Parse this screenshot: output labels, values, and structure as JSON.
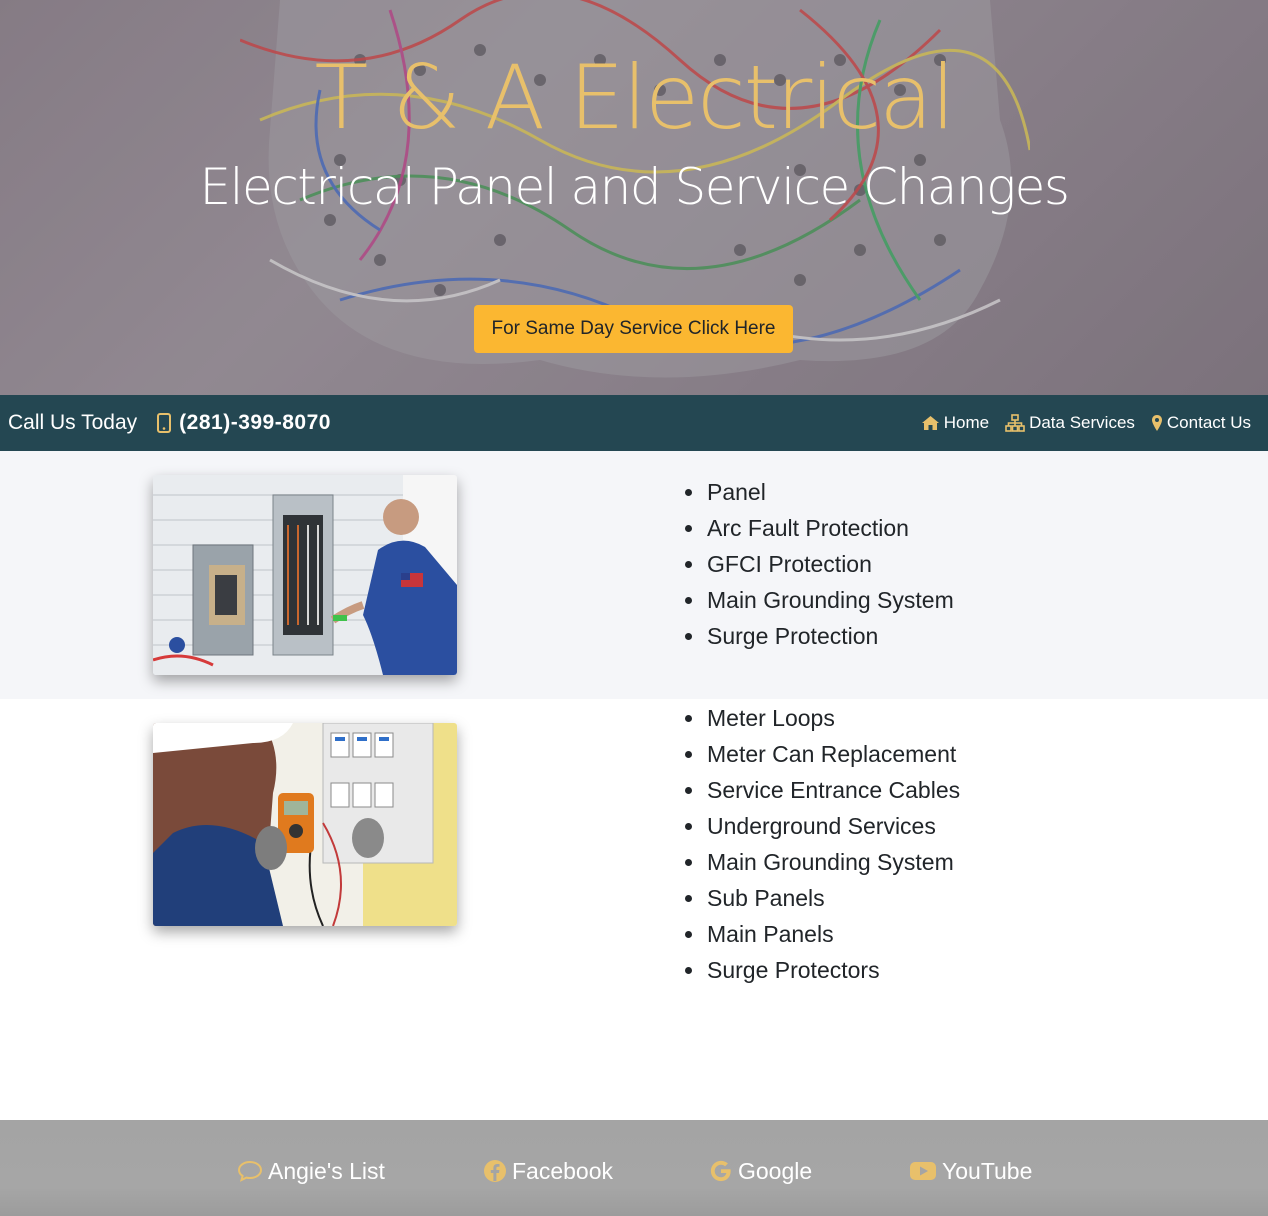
{
  "hero": {
    "title": "T & A Electrical",
    "subtitle": "Electrical Panel and Service Changes",
    "cta_label": "For Same Day Service Click Here"
  },
  "navbar": {
    "call_label": "Call Us Today",
    "phone_icon": "mobile-phone-icon",
    "phone": "(281)-399-8070",
    "links": [
      {
        "label": "Home",
        "icon": "home-icon"
      },
      {
        "label": "Data Services",
        "icon": "network-icon"
      },
      {
        "label": "Contact Us",
        "icon": "map-marker-icon"
      }
    ]
  },
  "sections": [
    {
      "image": "electrician-at-panel-photo",
      "items": [
        "Panel",
        "Arc Fault Protection",
        "GFCI Protection",
        "Main Grounding System",
        "Surge Protection"
      ]
    },
    {
      "image": "technician-with-multimeter-photo",
      "items": [
        "Meter Loops",
        "Meter Can Replacement",
        "Service Entrance Cables",
        "Underground Services",
        "Main Grounding System",
        "Sub Panels",
        "Main Panels",
        "Surge Protectors"
      ]
    }
  ],
  "footer": {
    "links": [
      {
        "label": "Angie's List",
        "icon": "comment-icon"
      },
      {
        "label": "Facebook",
        "icon": "facebook-icon"
      },
      {
        "label": "Google",
        "icon": "google-icon"
      },
      {
        "label": "YouTube",
        "icon": "youtube-icon"
      }
    ]
  },
  "colors": {
    "accent_gold": "#e8c06b",
    "cta_yellow": "#fbb731",
    "navbar_bg": "#244752",
    "section_alt_bg": "#f5f6f9",
    "footer_bg": "#a4a4a4"
  }
}
